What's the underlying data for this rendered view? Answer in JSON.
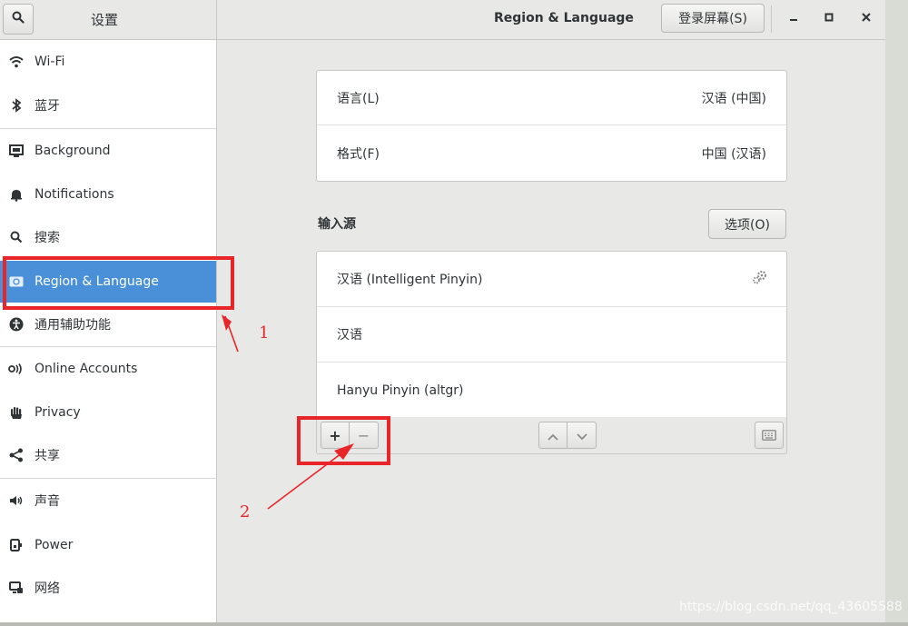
{
  "header": {
    "sidebar_title": "设置",
    "main_title": "Region & Language",
    "login_screen_button": "登录屏幕(S)"
  },
  "sidebar": {
    "items": [
      {
        "label": "Wi-Fi",
        "icon": "wifi-icon"
      },
      {
        "label": "蓝牙",
        "icon": "bluetooth-icon"
      },
      {
        "label": "Background",
        "icon": "background-icon"
      },
      {
        "label": "Notifications",
        "icon": "bell-icon"
      },
      {
        "label": "搜索",
        "icon": "search-icon"
      },
      {
        "label": "Region & Language",
        "icon": "region-language-icon",
        "active": true
      },
      {
        "label": "通用辅助功能",
        "icon": "accessibility-icon"
      },
      {
        "label": "Online Accounts",
        "icon": "online-accounts-icon"
      },
      {
        "label": "Privacy",
        "icon": "privacy-hand-icon"
      },
      {
        "label": "共享",
        "icon": "share-icon"
      },
      {
        "label": "声音",
        "icon": "speaker-icon"
      },
      {
        "label": "Power",
        "icon": "power-icon"
      },
      {
        "label": "网络",
        "icon": "network-icon"
      }
    ]
  },
  "language_card": {
    "rows": [
      {
        "key": "语言(L)",
        "value": "汉语 (中国)"
      },
      {
        "key": "格式(F)",
        "value": "中国 (汉语)"
      }
    ]
  },
  "input_sources": {
    "title": "输入源",
    "options_button": "选项(O)",
    "items": [
      {
        "label": "汉语 (Intelligent Pinyin)",
        "has_settings": true
      },
      {
        "label": "汉语"
      },
      {
        "label": "Hanyu Pinyin (altgr)"
      }
    ],
    "toolbar": {
      "add": "+",
      "remove": "−"
    }
  },
  "annotations": {
    "label_1": "1",
    "label_2": "2",
    "color": "#e8262a"
  },
  "watermark": "https://blog.csdn.net/qq_43605588",
  "colors": {
    "accent": "#4a90d9",
    "annotation_red": "#e8262a"
  }
}
